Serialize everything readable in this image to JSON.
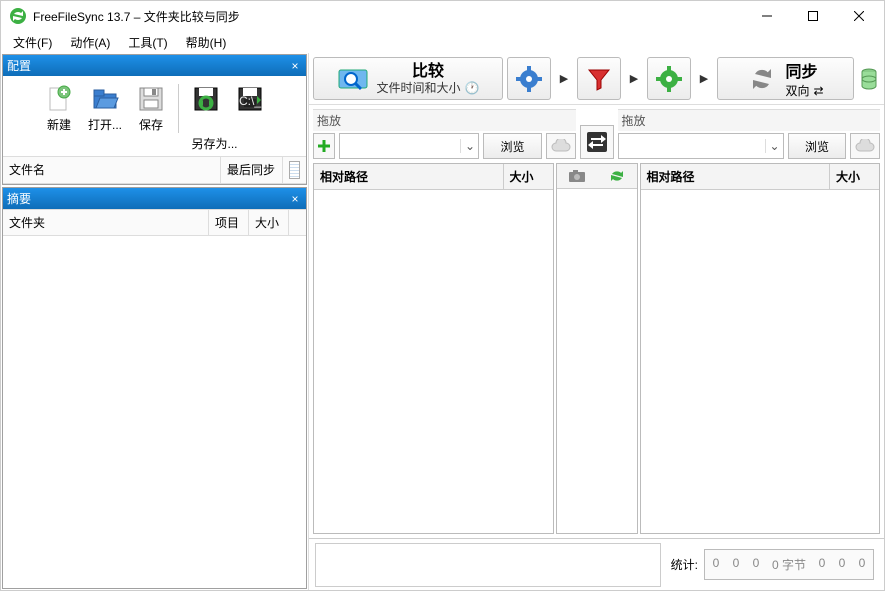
{
  "window": {
    "title": "FreeFileSync 13.7 – 文件夹比较与同步"
  },
  "menu": {
    "file": "文件(F)",
    "action": "动作(A)",
    "tools": "工具(T)",
    "help": "帮助(H)"
  },
  "config_panel": {
    "title": "配置",
    "new": "新建",
    "open": "打开...",
    "save": "保存",
    "save_as": "另存为...",
    "col_filename": "文件名",
    "col_last_sync": "最后同步"
  },
  "summary_panel": {
    "title": "摘要",
    "col_folder": "文件夹",
    "col_items": "项目",
    "col_size": "大小"
  },
  "actions": {
    "compare": "比较",
    "compare_sub": "文件时间和大小",
    "sync": "同步",
    "sync_sub": "双向"
  },
  "folders": {
    "drag_left": "拖放",
    "drag_right": "拖放",
    "browse": "浏览",
    "left_value": "",
    "right_value": ""
  },
  "grid": {
    "rel_path": "相对路径",
    "size": "大小"
  },
  "status": {
    "label": "统计:",
    "v1": "0",
    "v2": "0",
    "v3": "0",
    "bytes": "0 字节",
    "v4": "0",
    "v5": "0",
    "v6": "0"
  }
}
